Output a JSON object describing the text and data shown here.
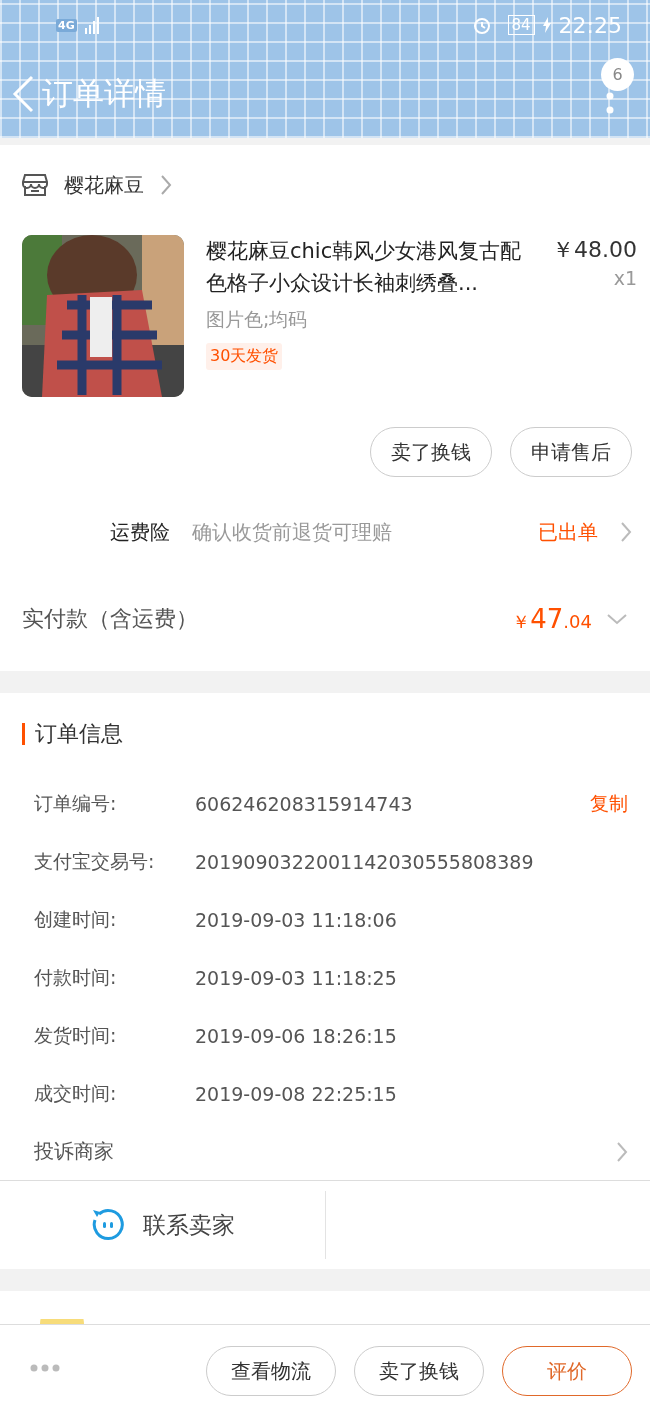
{
  "status_bar": {
    "network": "4G",
    "battery": "84",
    "time": "22:25"
  },
  "nav": {
    "title": "订单详情",
    "badge": "6"
  },
  "store": {
    "name": "樱花麻豆"
  },
  "product": {
    "title": "樱花麻豆chic韩风少女港风复古配色格子小众设计长袖刺绣叠...",
    "price": "￥48.00",
    "quantity": "x1",
    "spec": "图片色;均码",
    "tag": "30天发货"
  },
  "item_actions": [
    "卖了换钱",
    "申请售后"
  ],
  "insurance": {
    "label": "运费险",
    "description": "确认收货前退货可理赔",
    "status": "已出单"
  },
  "total": {
    "label": "实付款（含运费）",
    "currency": "￥",
    "integer": "47",
    "decimal": ".04"
  },
  "order_info": {
    "title": "订单信息",
    "rows": [
      {
        "label": "订单编号:",
        "value": "606246208315914743",
        "action": "复制"
      },
      {
        "label": "支付宝交易号:",
        "value": "2019090322001142030555808389"
      },
      {
        "label": "创建时间:",
        "value": "2019-09-03 11:18:06"
      },
      {
        "label": "付款时间:",
        "value": "2019-09-03 11:18:25"
      },
      {
        "label": "发货时间:",
        "value": "2019-09-06 18:26:15"
      },
      {
        "label": "成交时间:",
        "value": "2019-09-08 22:25:15"
      }
    ],
    "complaint": "投诉商家"
  },
  "contact": {
    "label": "联系卖家"
  },
  "bottom_actions": [
    {
      "label": "查看物流",
      "kind": "plain"
    },
    {
      "label": "卖了换钱",
      "kind": "plain"
    },
    {
      "label": "评价",
      "kind": "primary"
    }
  ]
}
